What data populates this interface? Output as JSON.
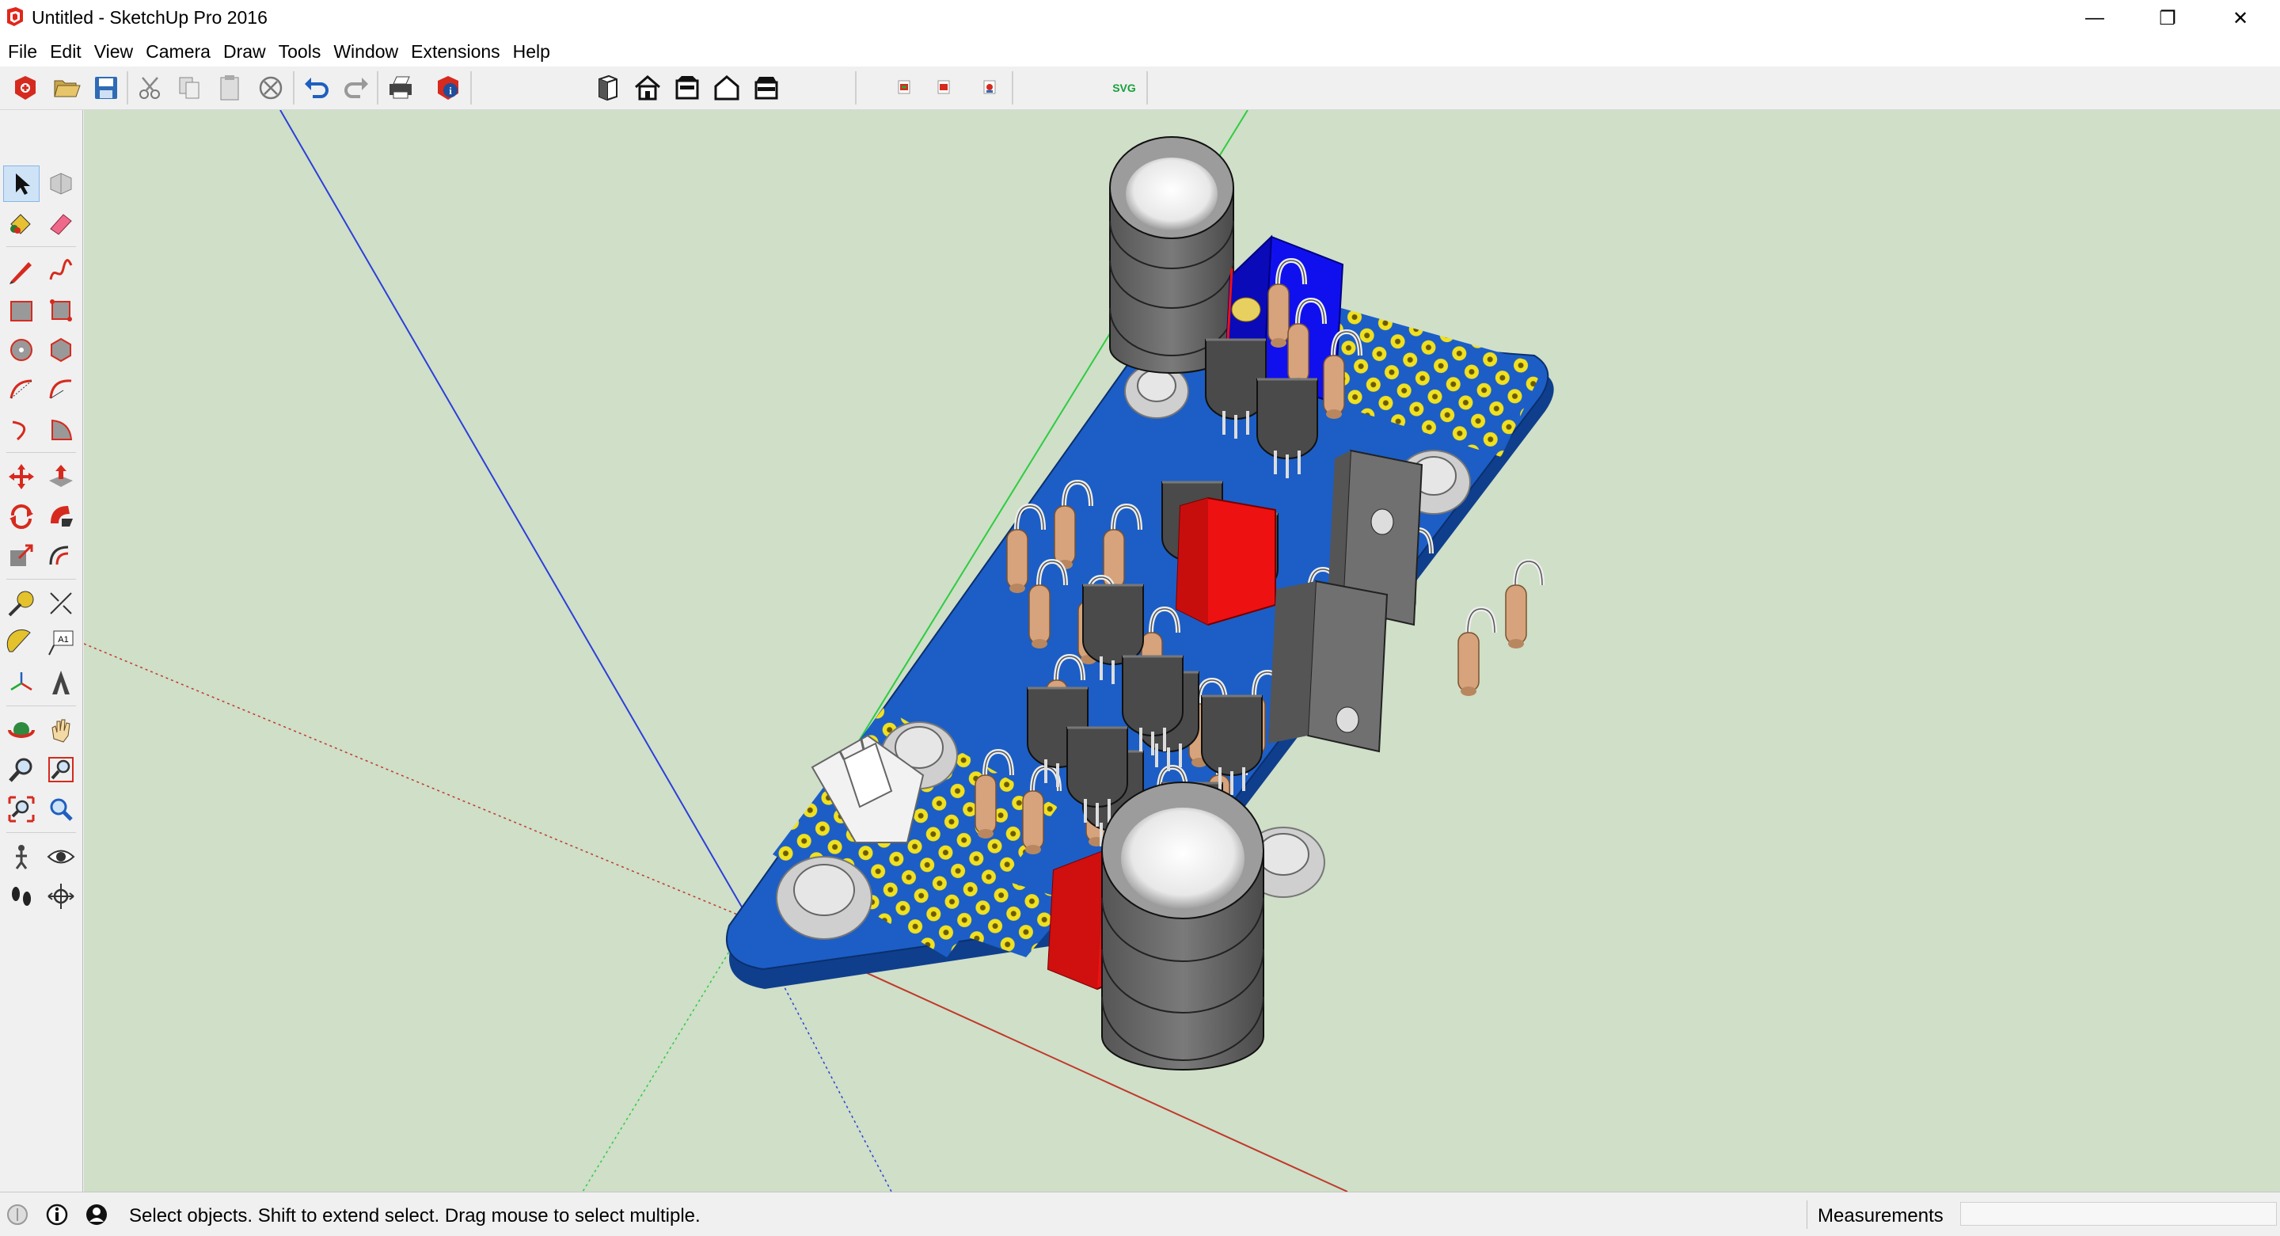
{
  "window": {
    "title": "Untitled - SketchUp Pro 2016",
    "minimize_glyph": "—",
    "restore_glyph": "❐",
    "close_glyph": "✕"
  },
  "menu": [
    "File",
    "Edit",
    "View",
    "Camera",
    "Draw",
    "Tools",
    "Window",
    "Extensions",
    "Help"
  ],
  "toolbar": {
    "svg_label": "SVG",
    "icons": [
      "new-model-icon",
      "open-icon",
      "save-icon",
      "cut-icon",
      "copy-icon",
      "paste-icon",
      "erase-icon",
      "undo-icon",
      "redo-icon",
      "print-icon",
      "model-info-icon",
      "iso-view-icon",
      "top-view-icon",
      "front-view-icon",
      "right-view-icon",
      "back-view-icon",
      "left-view-icon",
      "export-icon",
      "import-icon",
      "extension-icon",
      "svg-export-icon"
    ]
  },
  "palette": {
    "tools": [
      "select",
      "component",
      "paint-bucket",
      "eraser",
      "line",
      "freehand",
      "rectangle",
      "rotated-rectangle",
      "circle",
      "polygon",
      "arc",
      "two-point-arc",
      "three-point-arc",
      "pie",
      "move",
      "push-pull",
      "rotate",
      "follow-me",
      "scale",
      "offset",
      "tape-measure",
      "dimension",
      "protractor",
      "text",
      "axes",
      "3d-text",
      "orbit",
      "pan",
      "zoom",
      "zoom-window",
      "zoom-extents",
      "previous-view",
      "position-camera",
      "look-around",
      "walk",
      "section-plane"
    ]
  },
  "status": {
    "message": "Select objects. Shift to extend select. Drag mouse to select multiple.",
    "measurements_label": "Measurements",
    "measurements_value": ""
  },
  "colors": {
    "viewport_bg": "#cfdfc8",
    "pcb_blue": "#1c5ec5",
    "pcb_pads": "#f0e020",
    "resistor": "#d6a37c",
    "transistor": "#4a4a4a",
    "capacitor_red": "#ee1111",
    "axis_red": "#c0392b",
    "axis_green": "#2ecc40",
    "axis_blue": "#2c3fd8"
  }
}
